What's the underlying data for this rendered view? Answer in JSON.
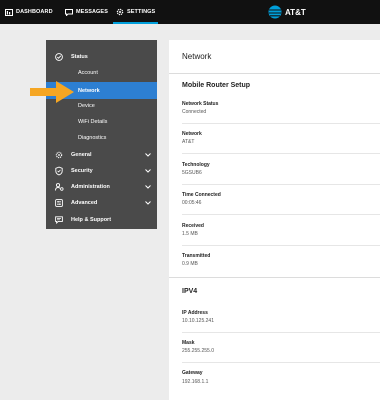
{
  "topnav": {
    "dashboard": "DASHBOARD",
    "messages": "MESSAGES",
    "settings": "SETTINGS",
    "brand": "AT&T"
  },
  "sidebar": {
    "status": "Status",
    "account": "Account",
    "network": "Network",
    "device": "Device",
    "wifi_details": "WiFi Details",
    "diagnostics": "Diagnostics",
    "general": "General",
    "security": "Security",
    "administration": "Administration",
    "advanced": "Advanced",
    "help": "Help & Support"
  },
  "panel": {
    "title": "Network",
    "section1": "Mobile Router Setup",
    "fields": [
      {
        "label": "Network Status",
        "value": "Connected"
      },
      {
        "label": "Network",
        "value": "AT&T"
      },
      {
        "label": "Technology",
        "value": "5GSUB6"
      },
      {
        "label": "Time Connected",
        "value": "00:05:46"
      },
      {
        "label": "Received",
        "value": "1.5 MB"
      },
      {
        "label": "Transmitted",
        "value": "0.9 MB"
      }
    ],
    "section2": "IPV4",
    "ipv4_fields": [
      {
        "label": "IP Address",
        "value": "10.10.125.241"
      },
      {
        "label": "Mask",
        "value": "255.255.255.0"
      },
      {
        "label": "Gateway",
        "value": "192.168.1.1"
      }
    ]
  },
  "colors": {
    "topbar": "#111111",
    "sidebar": "#4a4a4a",
    "active": "#2d7fd2",
    "arrow": "#f5a623",
    "tab_underline": "#009fdb"
  }
}
